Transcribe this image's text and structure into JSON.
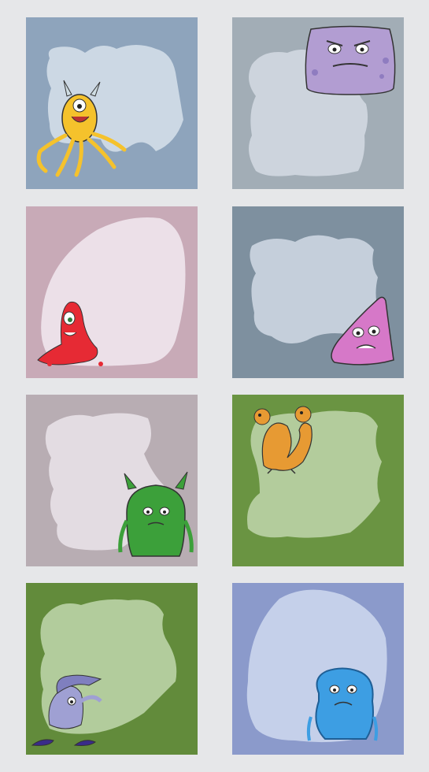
{
  "cards": [
    {
      "bg": "#8ea4bc",
      "blob": "#ccd8e4",
      "monster": "yellow-octopus-monster"
    },
    {
      "bg": "#a2adb6",
      "blob": "#cdd4dd",
      "monster": "purple-block-monster"
    },
    {
      "bg": "#c8aab7",
      "blob": "#ece0e8",
      "monster": "red-slime-monster"
    },
    {
      "bg": "#7e909f",
      "blob": "#c5cfdb",
      "monster": "pink-triangle-monster"
    },
    {
      "bg": "#b8adb3",
      "blob": "#e3dce2",
      "monster": "green-horned-monster"
    },
    {
      "bg": "#6a9442",
      "blob": "#b3cc9c",
      "monster": "orange-two-headed-dragon"
    },
    {
      "bg": "#628b3b",
      "blob": "#b2cc9c",
      "monster": "lavender-bird-monster"
    },
    {
      "bg": "#8b9acb",
      "blob": "#c5d0ea",
      "monster": "blue-furry-monster"
    }
  ]
}
